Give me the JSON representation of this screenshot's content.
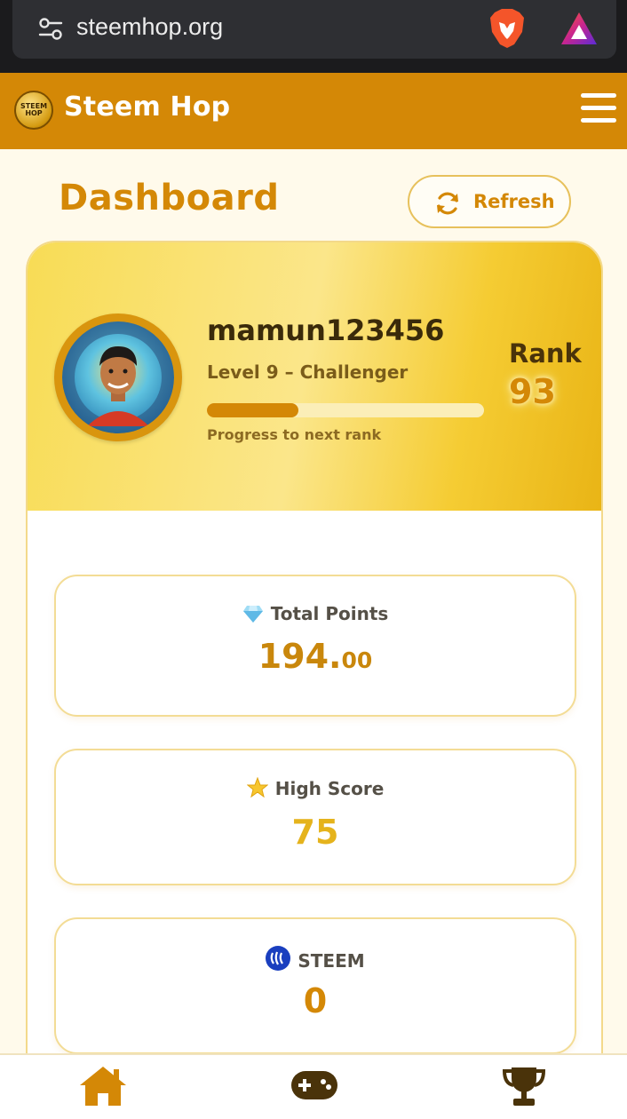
{
  "browser": {
    "url": "steemhop.org",
    "icons": [
      "site-settings-icon",
      "brave-lion-icon",
      "brave-rewards-icon"
    ]
  },
  "header": {
    "brand": "Steem Hop",
    "logo_text": "STEEM HOP",
    "menu_icon": "hamburger-menu-icon"
  },
  "dashboard": {
    "title": "Dashboard",
    "refresh_label": "Refresh",
    "refresh_icon": "refresh-icon"
  },
  "profile": {
    "username": "mamun123456",
    "level": "Level 9 – Challenger",
    "progress": 0.33,
    "progress_caption": "Progress to next rank",
    "rank_label": "Rank",
    "rank_value": "93",
    "avatar_caption": "@mamun123456"
  },
  "stats": {
    "points_label": "Total Points",
    "points_whole": "194.",
    "points_decimal": "00",
    "points_icon": "diamond-icon",
    "highscore_label": "High Score",
    "highscore_value": "75",
    "highscore_icon": "star-icon",
    "steem_label": "STEEM",
    "steem_value": "0",
    "steem_icon": "steem-logo-icon"
  },
  "nav": {
    "items": [
      "home-icon",
      "gamepad-icon",
      "trophy-icon"
    ]
  },
  "colors": {
    "brand": "#d48806",
    "page_bg": "#fffaeb",
    "banner_gold": "#f8dc55"
  }
}
